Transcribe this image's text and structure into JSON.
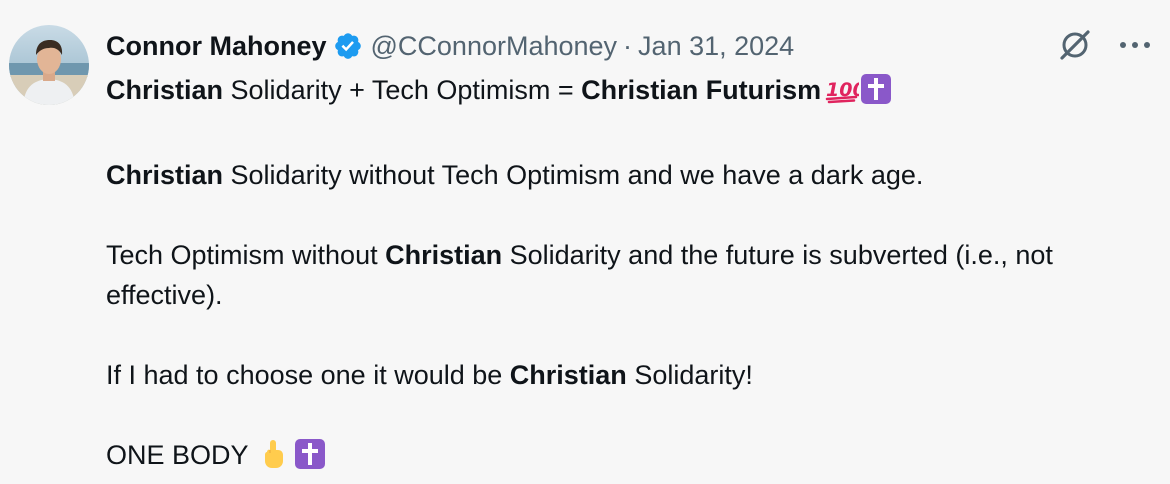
{
  "author": {
    "name": "Connor Mahoney",
    "handle": "@CConnorMahoney",
    "separator": "·",
    "date": "Jan 31, 2024",
    "verified": true
  },
  "icons": {
    "verified": "verified-badge-icon",
    "grok": "grok-icon",
    "more": "more-options-icon",
    "hundred": "hundred-points-emoji",
    "cross": "latin-cross-emoji",
    "finger": "index-pointing-up-emoji"
  },
  "colors": {
    "background": "#f7f7f7",
    "text": "#0f1419",
    "muted": "#536471",
    "verified": "#1d9bf0",
    "cross_emoji_bg": "#8a58c9",
    "hundred_emoji": "#e0245e"
  },
  "tweet": {
    "line1": {
      "b1": "Christian",
      "t1": " Solidarity + Tech Optimism = ",
      "b2": "Christian Futurism"
    },
    "line2": {
      "b1": "Christian",
      "t1": " Solidarity without Tech Optimism and we have a dark age."
    },
    "line3": {
      "t1": "Tech Optimism without ",
      "b1": "Christian",
      "t2": " Solidarity and the future is subverted (i.e., not effective)."
    },
    "line4": {
      "t1": "If I had to choose one it would be ",
      "b1": "Christian",
      "t2": " Solidarity!"
    },
    "line5": {
      "t1": "ONE BODY"
    }
  }
}
